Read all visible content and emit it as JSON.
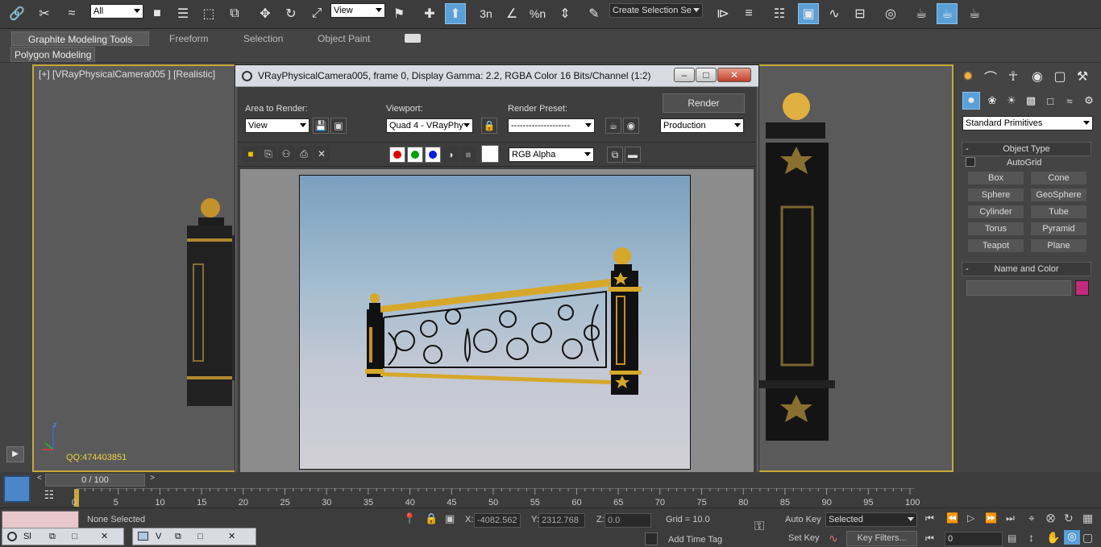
{
  "toolbar": {
    "selection_filter": "All",
    "ref_coord": "View",
    "snap_labels": [
      "3n",
      "%n"
    ],
    "selection_set": "Create Selection Se",
    "icons": [
      "link-icon",
      "unlink-icon",
      "bind-spacewarp-icon",
      "select-object-icon",
      "select-by-name-icon",
      "rect-region-icon",
      "window-crossing-icon",
      "move-icon",
      "rotate-icon",
      "scale-icon",
      "pivot-icon",
      "mirror-icon",
      "align-icon",
      "layer-manager-icon",
      "curve-editor-icon",
      "material-editor-icon",
      "render-setup-icon",
      "rendered-frame-icon",
      "render-teapot-icon"
    ]
  },
  "ribbon": {
    "tabs": [
      "Graphite Modeling Tools",
      "Freeform",
      "Selection",
      "Object Paint"
    ],
    "active_tab": "Graphite Modeling Tools",
    "sub_tab": "Polygon Modeling"
  },
  "viewport": {
    "label": "[+] [VRayPhysicalCamera005 ] [Realistic]",
    "watermark": "QQ:474403851",
    "axis_z": "z"
  },
  "dialog": {
    "title": "VRayPhysicalCamera005, frame 0, Display Gamma: 2.2, RGBA Color 16 Bits/Channel (1:2)",
    "area_label": "Area to Render:",
    "area_value": "View",
    "viewport_label": "Viewport:",
    "viewport_value": "Quad 4 - VRayPhy",
    "preset_label": "Render Preset:",
    "preset_value": "--------------------",
    "render_button": "Render",
    "mode_value": "Production",
    "channel_value": "RGB Alpha",
    "colors": {
      "red": "#e00000",
      "green": "#00a000",
      "blue": "#0020e0"
    }
  },
  "command_panel": {
    "category": "Standard Primitives",
    "object_type_title": "Object Type",
    "autogrid": "AutoGrid",
    "buttons": [
      "Box",
      "Cone",
      "Sphere",
      "GeoSphere",
      "Cylinder",
      "Tube",
      "Torus",
      "Pyramid",
      "Teapot",
      "Plane"
    ],
    "name_color_title": "Name and Color",
    "object_color": "#c22a7a"
  },
  "timeline": {
    "frame_counter": "0 / 100",
    "ticks": [
      "0",
      "5",
      "10",
      "15",
      "20",
      "25",
      "30",
      "35",
      "40",
      "45",
      "50",
      "55",
      "60",
      "65",
      "70",
      "75",
      "80",
      "85",
      "90",
      "95",
      "100"
    ]
  },
  "status": {
    "selection": "None Selected",
    "x_label": "X:",
    "x_value": "-4082.562",
    "y_label": "Y:",
    "y_value": "2312.768",
    "z_label": "Z:",
    "z_value": "0.0",
    "grid": "Grid = 10.0",
    "add_time_tag": "Add Time Tag",
    "auto_key": "Auto Key",
    "selected_value": "Selected",
    "set_key": "Set Key",
    "key_filters": "Key Filters...",
    "current_frame": "0"
  },
  "taskbar": {
    "win1": "Sl",
    "win2": "V"
  }
}
